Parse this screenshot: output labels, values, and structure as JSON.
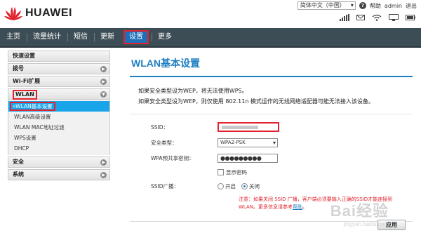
{
  "brand": {
    "name": "HUAWEI"
  },
  "header": {
    "language": "简体中文（中国）",
    "help": "?",
    "user_label": "帮助",
    "user": "admin",
    "logout": "退出"
  },
  "nav": {
    "items": [
      {
        "label": "主页"
      },
      {
        "label": "流量统计"
      },
      {
        "label": "短信"
      },
      {
        "label": "更新"
      },
      {
        "label": "设置"
      },
      {
        "label": "更多"
      }
    ]
  },
  "sidebar": {
    "items": [
      {
        "label": "快速设置"
      },
      {
        "label": "拨号"
      },
      {
        "label": "Wi-Fi扩展"
      },
      {
        "label": "WLAN"
      },
      {
        "label": "安全"
      },
      {
        "label": "系统"
      }
    ],
    "wlan_sub": [
      {
        "label": "»WLAN基本设置"
      },
      {
        "label": "WLAN高级设置"
      },
      {
        "label": "WLAN MAC地址过滤"
      },
      {
        "label": "WPS设置"
      },
      {
        "label": "DHCP"
      }
    ]
  },
  "main": {
    "title": "WLAN基本设置",
    "note1": "如果安全类型设为WEP，将无法使用WPS。",
    "note2": "如果安全类型设为WEP，则仅使用 802.11n 模式运作的无线网络适配器可能无法接入该设备。",
    "ssid_label": "SSID：",
    "security_label": "安全类型：",
    "security_value": "WPA2-PSK",
    "psk_label": "WPA预共享密钥：",
    "psk_value": "●●●●●●●●●",
    "show_password": "显示密码",
    "broadcast_label": "SSID广播：",
    "broadcast_on": "开启",
    "broadcast_off": "关闭",
    "warning": "注意：如果关闭 SSID 广播，客户端必须要输入正确的SSID才能连接到WLAN。更多信息请参考",
    "warning_link": "帮助",
    "warning_end": "。",
    "apply": "应用"
  },
  "watermark": {
    "text": "Bai经验",
    "sub": "jingyan.baidu.com"
  }
}
